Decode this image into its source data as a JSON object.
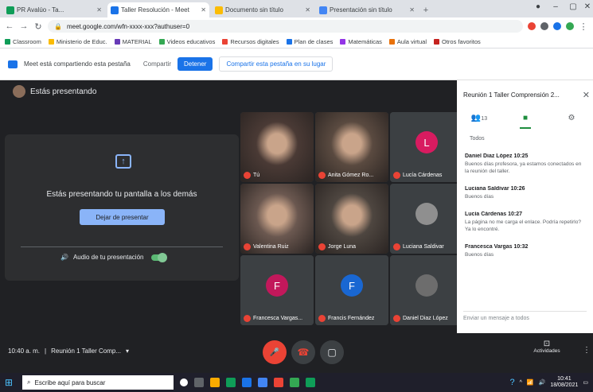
{
  "colors": {
    "accent_blue": "#1a73e8",
    "meet_dark": "#202124",
    "end_call_red": "#ea4335",
    "chat_green": "#1e8e3e",
    "tile_gray": "#3c4043"
  },
  "browser": {
    "tabs": [
      {
        "label": "PR Avalúo - Ta...",
        "color": "#0f9d58",
        "active": false
      },
      {
        "label": "Taller Resolución - Meet",
        "color": "#1a73e8",
        "active": true
      },
      {
        "label": "Documento sin título",
        "color": "#fbbc04",
        "active": false
      },
      {
        "label": "Presentación sin título",
        "color": "#4285f4",
        "active": false
      }
    ],
    "address": "meet.google.com/wfn-xxxx-xxx?authuser=0",
    "address_hint": "",
    "bookmarks": [
      {
        "label": "Classroom",
        "color": "#0f9d58"
      },
      {
        "label": "Ministerio de Educ.",
        "color": "#fbbc04"
      },
      {
        "label": "MATERIAL",
        "color": "#673ab7"
      },
      {
        "label": "Videos educativos",
        "color": "#34a853"
      },
      {
        "label": "Recursos digitales",
        "color": "#ea4335"
      },
      {
        "label": "Plan de clases",
        "color": "#1a73e8"
      },
      {
        "label": "Matemáticas",
        "color": "#9334e6"
      },
      {
        "label": "Aula virtual",
        "color": "#e8710a"
      },
      {
        "label": "Otros favoritos",
        "color": "#c5221f"
      }
    ]
  },
  "infobar": {
    "message": "Meet está compartiendo esta pestaña",
    "secondary": "Compartir",
    "primary_button": "Detener",
    "outline_button": "Compartir esta pestaña en su lugar"
  },
  "meet": {
    "presenter_label": "Estás presentando",
    "share_panel": {
      "message": "Estás presentando tu pantalla a los demás",
      "stop_button": "Dejar de presentar",
      "audio_label": "Audio de tu presentación"
    },
    "tiles": [
      {
        "name": "Tú",
        "kind": "video",
        "bg": "#4a3a35"
      },
      {
        "name": "Anita Gómez Ro...",
        "kind": "video",
        "bg": "#5a4a40"
      },
      {
        "name": "Lucía Cárdenas",
        "kind": "avatar",
        "initial": "L",
        "avatar_color": "#d81b60",
        "bg": "#3c4043"
      },
      {
        "name": "Valentina Ruiz",
        "kind": "video",
        "bg": "#6b5850"
      },
      {
        "name": "Jorge Luna",
        "kind": "video",
        "bg": "#4e4640"
      },
      {
        "name": "Luciana Saldivar",
        "kind": "photo",
        "bg": "#3c4043",
        "avatar_color": "#8f8f8f"
      },
      {
        "name": "Francesca Vargas...",
        "kind": "avatar",
        "initial": "F",
        "avatar_color": "#c2185b",
        "bg": "#3c4043"
      },
      {
        "name": "Francis Fernández",
        "kind": "avatar",
        "initial": "F",
        "avatar_color": "#1967d2",
        "bg": "#3c4043"
      },
      {
        "name": "Daniel Diaz López",
        "kind": "photo",
        "bg": "#3c4043",
        "avatar_color": "#6d6d6d"
      }
    ]
  },
  "side_panel": {
    "title": "Reunión 1 Taller Comprensión 2...",
    "tabs": [
      {
        "icon": "people-icon",
        "glyph": "👥",
        "count": "13"
      },
      {
        "icon": "chat-icon",
        "glyph": "■",
        "count": ""
      },
      {
        "icon": "activities-icon",
        "glyph": "⚙",
        "count": ""
      }
    ],
    "participants_caption": "Todos",
    "messages": [
      {
        "who": "Daniel Diaz López  10:25",
        "text": "Buenos días profesora, ya estamos conectados en la reunión del taller."
      },
      {
        "who": "Luciana Saldivar  10:26",
        "text": "Buenos días"
      },
      {
        "who": "Lucía Cárdenas  10:27",
        "text": "La página no me carga el enlace. Podría repetirlo? Ya lo encontré."
      },
      {
        "who": "Francesca Vargas  10:32",
        "text": "Buenos días"
      }
    ],
    "input_placeholder": "Enviar un mensaje a todos"
  },
  "controls": {
    "meeting_time": "10:40 a. m.",
    "meeting_code": "Reunión 1 Taller Comp...",
    "activities_label": "Actividades",
    "mic_glyph": "🎤",
    "hangup_glyph": "☎",
    "present_glyph": "▢"
  },
  "taskbar": {
    "search_placeholder": "Escribe aquí para buscar",
    "time": "10:41",
    "date": "18/08/2021"
  }
}
